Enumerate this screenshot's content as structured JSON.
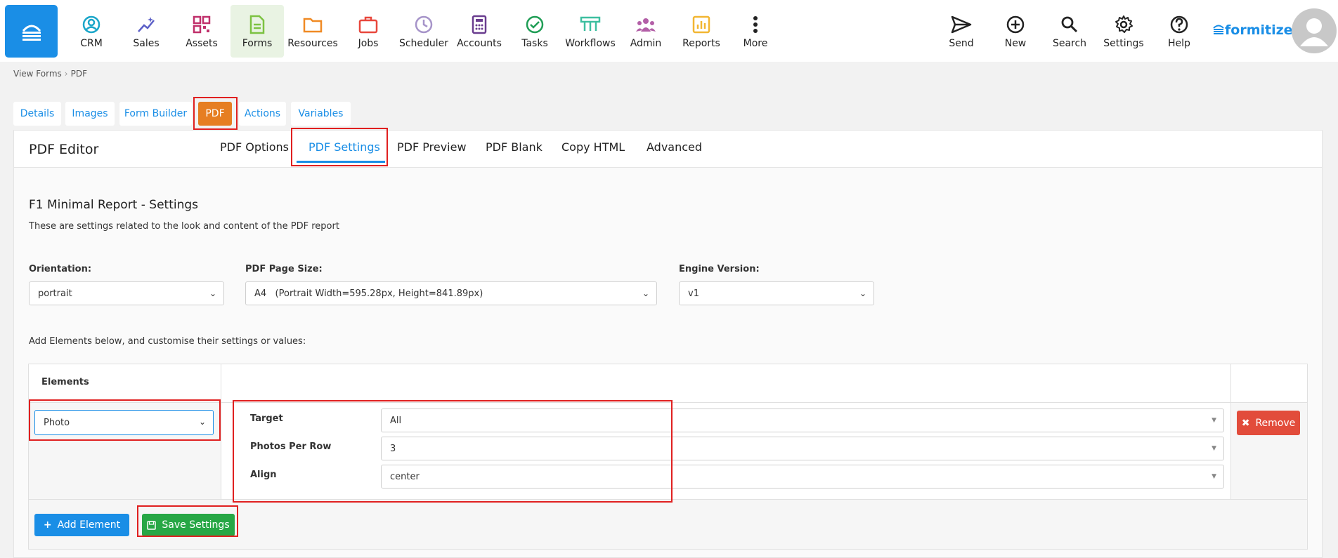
{
  "nav": {
    "items": [
      {
        "label": "CRM",
        "icon": "crm-icon"
      },
      {
        "label": "Sales",
        "icon": "sales-icon"
      },
      {
        "label": "Assets",
        "icon": "assets-icon"
      },
      {
        "label": "Forms",
        "icon": "forms-icon"
      },
      {
        "label": "Resources",
        "icon": "resources-icon"
      },
      {
        "label": "Jobs",
        "icon": "jobs-icon"
      },
      {
        "label": "Scheduler",
        "icon": "scheduler-icon"
      },
      {
        "label": "Accounts",
        "icon": "accounts-icon"
      },
      {
        "label": "Tasks",
        "icon": "tasks-icon"
      },
      {
        "label": "Workflows",
        "icon": "workflows-icon"
      },
      {
        "label": "Admin",
        "icon": "admin-icon"
      },
      {
        "label": "Reports",
        "icon": "reports-icon"
      },
      {
        "label": "More",
        "icon": "more-icon"
      }
    ],
    "right_items": [
      {
        "label": "Send",
        "icon": "send-icon"
      },
      {
        "label": "New",
        "icon": "plus-circle-icon"
      },
      {
        "label": "Search",
        "icon": "search-icon"
      },
      {
        "label": "Settings",
        "icon": "gear-icon"
      },
      {
        "label": "Help",
        "icon": "help-icon"
      }
    ],
    "brand": "formitize"
  },
  "breadcrumb": [
    "View Forms",
    "PDF"
  ],
  "top_tabs": [
    "Details",
    "Images",
    "Form Builder",
    "PDF",
    "Actions",
    "Variables"
  ],
  "panel": {
    "title": "PDF Editor",
    "tabs": [
      "PDF Options",
      "PDF Settings",
      "PDF Preview",
      "PDF Blank",
      "Copy HTML",
      "Advanced"
    ]
  },
  "settings": {
    "heading": "F1 Minimal Report - Settings",
    "description": "These are settings related to the look and content of the PDF report",
    "orientation_label": "Orientation:",
    "orientation_value": "portrait",
    "page_size_label": "PDF Page Size:",
    "page_size_value": "A4   (Portrait Width=595.28px, Height=841.89px)",
    "engine_label": "Engine Version:",
    "engine_value": "v1",
    "elements_intro": "Add Elements below, and customise their settings or values:"
  },
  "elements": {
    "header": "Elements",
    "selected": "Photo",
    "fields": [
      {
        "label": "Target",
        "value": "All"
      },
      {
        "label": "Photos Per Row",
        "value": "3"
      },
      {
        "label": "Align",
        "value": "center"
      }
    ],
    "remove_label": "Remove",
    "add_label": "Add Element",
    "save_label": "Save Settings"
  },
  "colors": {
    "accent": "#1a8ee6",
    "highlight": "#e02020",
    "pdf_tab": "#e67e22",
    "save": "#27a745",
    "remove": "#e24c3b"
  }
}
